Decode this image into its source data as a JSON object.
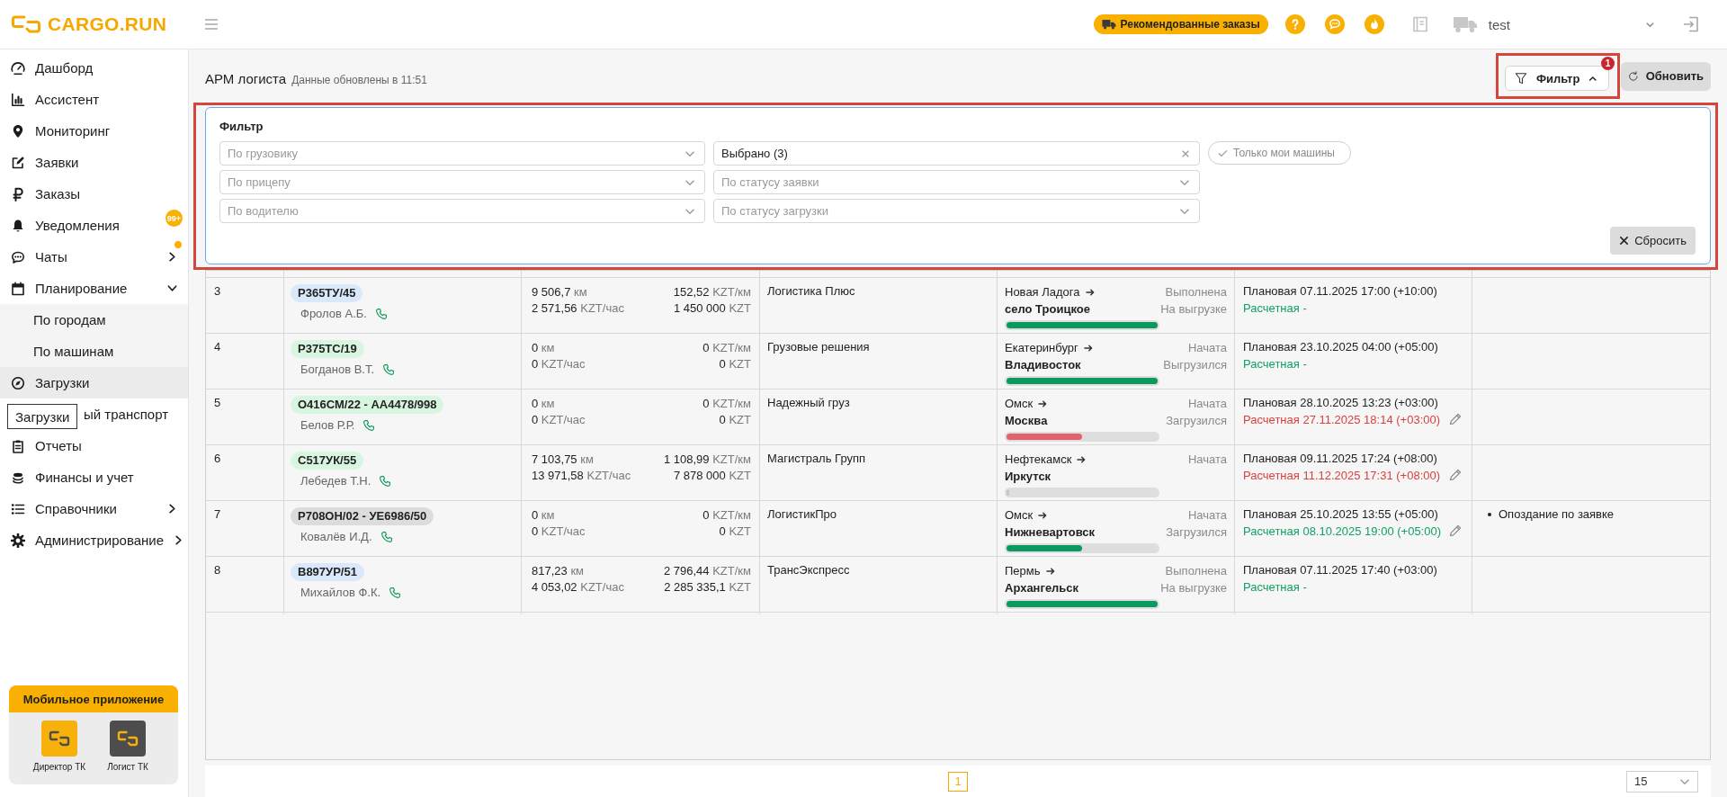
{
  "topbar": {
    "logo": "CARGO.RUN",
    "recommended_button": "Рекомендованные заказы",
    "user": "test"
  },
  "sidebar": {
    "items": [
      {
        "label": "Дашборд",
        "selected": false
      },
      {
        "label": "Ассистент",
        "selected": false
      },
      {
        "label": "Мониторинг",
        "selected": false
      },
      {
        "label": "Заявки",
        "selected": false
      },
      {
        "label": "Заказы",
        "selected": false
      },
      {
        "label": "Уведомления",
        "selected": false,
        "badge": "99+"
      },
      {
        "label": "Чаты",
        "selected": false,
        "expanded": false,
        "unread": true
      },
      {
        "label": "Планирование",
        "selected": false,
        "expanded": true,
        "children": [
          {
            "label": "По городам",
            "selected": false
          },
          {
            "label": "По машинам",
            "selected": false
          }
        ]
      },
      {
        "label": "Загрузки",
        "selected": true
      },
      {
        "label": "ый транспорт",
        "selected": false,
        "partly_hidden": true
      },
      {
        "label": "Отчеты",
        "selected": false
      },
      {
        "label": "Финансы и учет",
        "selected": false
      },
      {
        "label": "Справочники",
        "selected": false,
        "expanded": false
      },
      {
        "label": "Администрирование",
        "selected": false,
        "expanded": false
      }
    ],
    "tooltip": "Загрузки",
    "mobile_app": {
      "title": "Мобильное приложение",
      "apps": [
        {
          "label": "Директор ТК",
          "color": "#f7b10a"
        },
        {
          "label": "Логист ТК",
          "color": "#4d4d4d"
        }
      ]
    }
  },
  "header": {
    "title": "АРМ логиста",
    "updated": "Данные обновлены в 11:51",
    "filter_button": {
      "label": "Фильтр",
      "badge": "1",
      "expanded": true
    },
    "refresh_button": "Обновить"
  },
  "filter": {
    "title": "Фильтр",
    "fields": [
      {
        "placeholder": "По грузовику"
      },
      {
        "value": "Выбрано (3)"
      },
      {
        "placeholder": "По прицепу"
      },
      {
        "placeholder": "По статусу заявки"
      },
      {
        "placeholder": "По водителю"
      },
      {
        "placeholder": "По статусу загрузки"
      }
    ],
    "only_mine": {
      "label": "Только мои машины",
      "selected": false
    },
    "reset_button": "Сбросить"
  },
  "table": {
    "rows": [
      {
        "number": "3",
        "plate": {
          "label": "Р365ТУ/45",
          "color": "#d9e9fb"
        },
        "driver": "Фролов А.Б.",
        "metrics": [
          {
            "value": "9 506,7",
            "unit": "км"
          },
          {
            "value": "152,52",
            "unit": "KZT/км"
          },
          {
            "value": "2 571,56",
            "unit": "KZT/час"
          },
          {
            "value": "1 450 000",
            "unit": "KZT"
          }
        ],
        "company": "Логистика Плюс",
        "from": "Новая Ладога",
        "to": "село Троицкое",
        "status": "Выполнена",
        "substatus": "На выгрузке",
        "level": 1,
        "planned": "Плановая 07.11.2025 17:00 (+10:00)",
        "estimated": "Расчетная -",
        "late": false,
        "editable": false
      },
      {
        "number": "4",
        "plate": {
          "label": "Р375ТС/19",
          "color": "#d8f5e0"
        },
        "driver": "Богданов В.Т.",
        "metrics": [
          {
            "value": "0",
            "unit": "км"
          },
          {
            "value": "0",
            "unit": "KZT/км"
          },
          {
            "value": "0",
            "unit": "KZT/час"
          },
          {
            "value": "0",
            "unit": "KZT"
          }
        ],
        "company": "Грузовые решения",
        "from": "Екатеринбург",
        "to": "Владивосток",
        "status": "Начата",
        "substatus": "Выгрузился",
        "level": 1,
        "planned": "Плановая 23.10.2025 04:00 (+05:00)",
        "estimated": "Расчетная -",
        "late": false,
        "editable": false
      },
      {
        "number": "5",
        "plate": {
          "label": "О416СМ/22 - АА4478/998",
          "color": "#d8f5e0"
        },
        "driver": "Белов Р.Р.",
        "metrics": [
          {
            "value": "0",
            "unit": "км"
          },
          {
            "value": "0",
            "unit": "KZT/км"
          },
          {
            "value": "0",
            "unit": "KZT/час"
          },
          {
            "value": "0",
            "unit": "KZT"
          }
        ],
        "company": "Надежный груз",
        "from": "Омск",
        "to": "Москва",
        "status": "Начата",
        "substatus": "Загрузился",
        "level": 0.5,
        "planned": "Плановая 28.10.2025 13:23 (+03:00)",
        "estimated": "Расчетная 27.11.2025 18:14 (+03:00)",
        "late": true,
        "editable": true
      },
      {
        "number": "6",
        "plate": {
          "label": "С517УК/55",
          "color": "#d8f5e0"
        },
        "driver": "Лебедев Т.Н.",
        "metrics": [
          {
            "value": "7 103,75",
            "unit": "км"
          },
          {
            "value": "1 108,99",
            "unit": "KZT/км"
          },
          {
            "value": "13 971,58",
            "unit": "KZT/час"
          },
          {
            "value": "7 878 000",
            "unit": "KZT"
          }
        ],
        "company": "Магистраль Групп",
        "from": "Нефтекамск",
        "to": "Иркутск",
        "status": "Начата",
        "level": 0,
        "planned": "Плановая 09.11.2025 17:24 (+08:00)",
        "estimated": "Расчетная 11.12.2025 17:31 (+08:00)",
        "late": true,
        "editable": true
      },
      {
        "number": "7",
        "plate": {
          "label": "Р708ОН/02 - УЕ6986/50",
          "color": "#dcdcdc"
        },
        "driver": "Ковалёв И.Д.",
        "metrics": [
          {
            "value": "0",
            "unit": "км"
          },
          {
            "value": "0",
            "unit": "KZT/км"
          },
          {
            "value": "0",
            "unit": "KZT/час"
          },
          {
            "value": "0",
            "unit": "KZT"
          }
        ],
        "company": "ЛогистикПро",
        "from": "Омск",
        "to": "Нижневартовск",
        "status": "Начата",
        "substatus": "Загрузился",
        "level": 0.5,
        "planned": "Плановая 25.10.2025 13:55 (+05:00)",
        "estimated": "Расчетная 08.10.2025 19:00 (+05:00)",
        "late": false,
        "editable": true,
        "notes": [
          "Опоздание по заявке"
        ]
      },
      {
        "number": "8",
        "plate": {
          "label": "В897УР/51",
          "color": "#d9e9fb"
        },
        "driver": "Михайлов Ф.К.",
        "metrics": [
          {
            "value": "817,23",
            "unit": "км"
          },
          {
            "value": "2 796,44",
            "unit": "KZT/км"
          },
          {
            "value": "4 053,02",
            "unit": "KZT/час"
          },
          {
            "value": "2 285 335,1",
            "unit": "KZT"
          }
        ],
        "company": "ТрансЭкспресс",
        "from": "Пермь",
        "to": "Архангельск",
        "status": "Выполнена",
        "substatus": "На выгрузке",
        "level": 1,
        "planned": "Плановая 07.11.2025 17:40 (+03:00)",
        "estimated": "Расчетная -",
        "late": false,
        "editable": false
      }
    ]
  },
  "pagination": {
    "pages": [
      {
        "label": "1",
        "selected": true
      }
    ],
    "page_size": "15"
  }
}
